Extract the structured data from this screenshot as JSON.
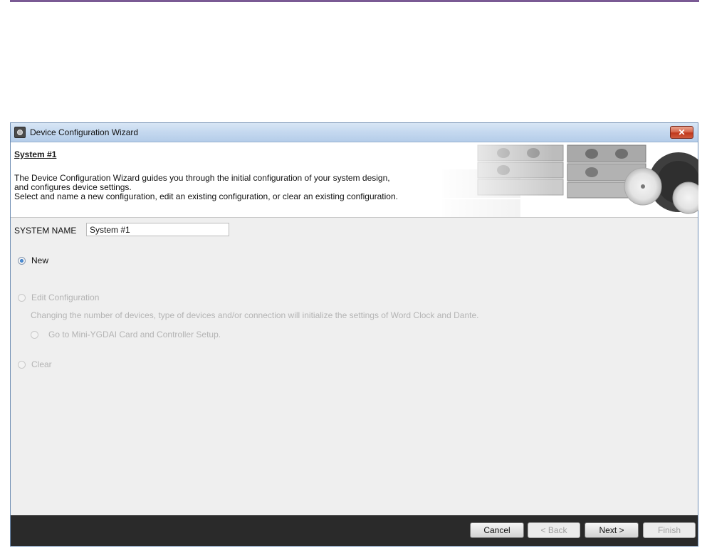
{
  "window": {
    "title": "Device Configuration Wizard",
    "close_label": "✕"
  },
  "header": {
    "system_title": "System #1",
    "description_lines": [
      "The Device Configuration Wizard guides you through the initial configuration of your system design,",
      "and configures device settings.",
      "Select and name a new configuration, edit an existing configuration, or clear an existing configuration."
    ]
  },
  "system_name": {
    "label": "SYSTEM NAME",
    "value": "System #1"
  },
  "options": {
    "new": {
      "label": "New",
      "checked": true,
      "enabled": true
    },
    "edit": {
      "label": "Edit Configuration",
      "checked": false,
      "enabled": false
    },
    "edit_note": "Changing the number of devices, type of devices and/or connection will initialize the settings of Word Clock and Dante.",
    "mini_ygdai": {
      "label": "Go to Mini-YGDAI Card and Controller Setup.",
      "checked": false,
      "enabled": false
    },
    "clear": {
      "label": "Clear",
      "checked": false,
      "enabled": false
    }
  },
  "buttons": {
    "cancel": "Cancel",
    "back": "< Back",
    "next": "Next >",
    "finish": "Finish"
  },
  "colors": {
    "footer": "#2a2a2a",
    "titlebar": "#c4d8ef",
    "accent_rule": "#7a5a94"
  }
}
